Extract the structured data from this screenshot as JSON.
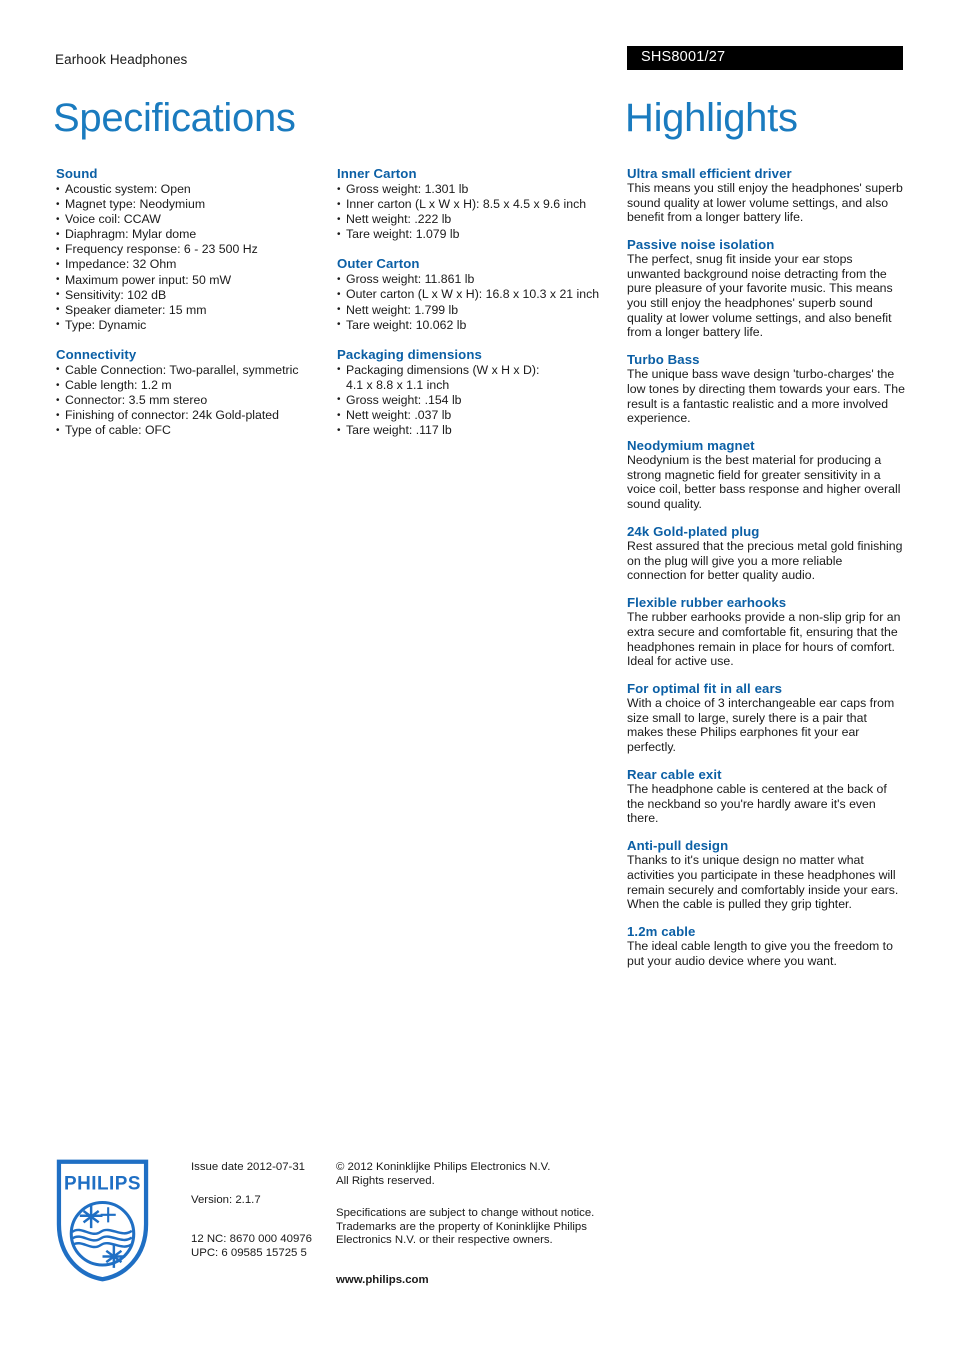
{
  "header": {
    "product_line": "Earhook Headphones",
    "product_code": "SHS8001/27",
    "title_left": "Specifications",
    "title_right": "Highlights"
  },
  "colors": {
    "heading_blue": "#0b5fa5",
    "title_blue": "#1a7bbf",
    "code_bar_bg": "#000000",
    "text": "#1a1a1a"
  },
  "specs_col_1": [
    {
      "heading": "Sound",
      "items": [
        "Acoustic system: Open",
        "Magnet type: Neodymium",
        "Voice coil: CCAW",
        "Diaphragm: Mylar dome",
        "Frequency response: 6 - 23 500 Hz",
        "Impedance: 32 Ohm",
        "Maximum power input: 50 mW",
        "Sensitivity: 102 dB",
        "Speaker diameter: 15 mm",
        "Type: Dynamic"
      ]
    },
    {
      "heading": "Connectivity",
      "items": [
        "Cable Connection: Two-parallel, symmetric",
        "Cable length: 1.2 m",
        "Connector: 3.5 mm stereo",
        "Finishing of connector: 24k Gold-plated",
        "Type of cable: OFC"
      ]
    }
  ],
  "specs_col_2": [
    {
      "heading": "Inner Carton",
      "items": [
        "Gross weight: 1.301 lb",
        "Inner carton (L x W x H): 8.5 x 4.5 x 9.6 inch",
        "Nett weight: .222 lb",
        "Tare weight: 1.079 lb"
      ]
    },
    {
      "heading": "Outer Carton",
      "items": [
        "Gross weight: 11.861 lb",
        "Outer carton (L x W x H): 16.8 x 10.3 x 21 inch",
        "Nett weight: 1.799 lb",
        "Tare weight: 10.062 lb"
      ]
    },
    {
      "heading": "Packaging dimensions",
      "items": [
        "Packaging dimensions (W x H x D):\n  4.1 x 8.8 x 1.1 inch",
        "Gross weight: .154 lb",
        "Nett weight: .037 lb",
        "Tare weight: .117 lb"
      ]
    }
  ],
  "highlights": [
    {
      "heading": "Ultra small efficient driver",
      "body": "This means you still enjoy the headphones' superb sound quality at lower volume settings, and also benefit from a longer battery life."
    },
    {
      "heading": "Passive noise isolation",
      "body": "The perfect, snug fit inside your ear stops unwanted background noise detracting from the pure pleasure of your favorite music. This means you still enjoy the headphones' superb sound quality at lower volume settings, and also benefit from a longer battery life."
    },
    {
      "heading": "Turbo Bass",
      "body": "The unique bass wave design 'turbo-charges' the low tones by directing them towards your ears. The result is a fantastic realistic and a more involved experience."
    },
    {
      "heading": "Neodymium magnet",
      "body": "Neodynium is the best material for producing a strong magnetic field for greater sensitivity in a voice coil, better bass response and higher overall sound quality."
    },
    {
      "heading": "24k Gold-plated plug",
      "body": "Rest assured that the precious metal gold finishing on the plug will give you a more reliable connection for better quality audio."
    },
    {
      "heading": "Flexible rubber earhooks",
      "body": "The rubber earhooks provide a non-slip grip for an extra secure and comfortable fit, ensuring that the headphones remain in place for hours of comfort. Ideal for active use."
    },
    {
      "heading": "For optimal fit in all ears",
      "body": "With a choice of 3 interchangeable ear caps from size small to large, surely there is a pair that makes these Philips earphones fit your ear perfectly."
    },
    {
      "heading": "Rear cable exit",
      "body": "The headphone cable is centered at the back of the neckband so you're hardly aware it's even there."
    },
    {
      "heading": "Anti-pull design",
      "body": "Thanks to it's unique design no matter what activities you participate in these headphones will remain securely and comfortably inside your ears. When the cable is pulled they grip tighter."
    },
    {
      "heading": "1.2m cable",
      "body": "The ideal cable length to give you the freedom to put your audio device where you want."
    }
  ],
  "footer": {
    "logo_text": "PHILIPS",
    "issue_date": "Issue date 2012-07-31",
    "version": "Version: 2.1.7",
    "nc_code": "12 NC: 8670 000 40976",
    "upc_code": "UPC: 6 09585 15725 5",
    "copyright": "© 2012 Koninklijke Philips Electronics N.V.\nAll Rights reserved.",
    "disclaimer": "Specifications are subject to change without notice.\nTrademarks are the property of Koninklijke Philips\nElectronics N.V. or their respective owners.",
    "website": "www.philips.com"
  }
}
